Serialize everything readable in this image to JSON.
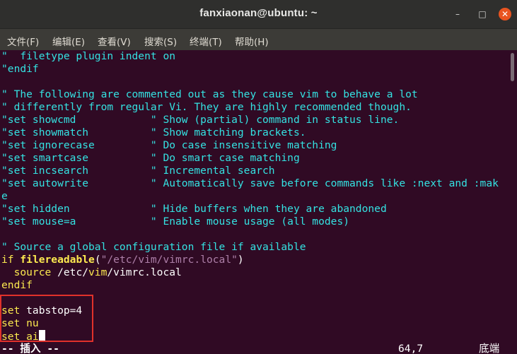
{
  "window": {
    "title": "fanxiaonan@ubuntu: ~",
    "buttons": {
      "minimize": "–",
      "maximize": "□",
      "close": "✕"
    }
  },
  "menubar": {
    "items": [
      "文件(F)",
      "编辑(E)",
      "查看(V)",
      "搜索(S)",
      "终端(T)",
      "帮助(H)"
    ]
  },
  "terminal": {
    "lines": [
      "\"  filetype plugin indent on",
      "\"endif",
      "",
      "\" The following are commented out as they cause vim to behave a lot",
      "\" differently from regular Vi. They are highly recommended though.",
      "\"set showcmd            \" Show (partial) command in status line.",
      "\"set showmatch          \" Show matching brackets.",
      "\"set ignorecase         \" Do case insensitive matching",
      "\"set smartcase          \" Do smart case matching",
      "\"set incsearch          \" Incremental search",
      "\"set autowrite          \" Automatically save before commands like :next and :mak",
      "e",
      "\"set hidden             \" Hide buffers when they are abandoned",
      "\"set mouse=a            \" Enable mouse usage (all modes)",
      "",
      "\" Source a global configuration file if available",
      "",
      "",
      "endif",
      "",
      "",
      "",
      ""
    ],
    "line14": {
      "kw": "if",
      "fn": "filereadable",
      "p1": "(",
      "str": "\"/etc/vim/vimrc.local\"",
      "p2": ")"
    },
    "line15": {
      "kw": "  source",
      "a": " /etc/",
      "b": "vim",
      "c": "/vimrc.local"
    },
    "setlines": {
      "kw": "set",
      "tabstop": " tabstop=4",
      "nu": " nu",
      "ai": " ai"
    }
  },
  "statusline": {
    "mode": "-- 插入 --",
    "position": "64,7",
    "scroll": "底端"
  }
}
